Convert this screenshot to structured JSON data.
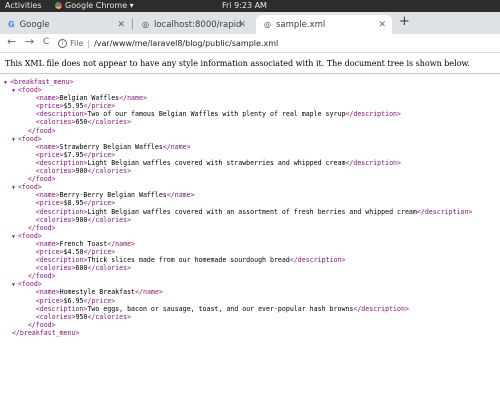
{
  "topbar": {
    "activities": "Activities",
    "app_name": "Google Chrome ▾",
    "clock": "Fri  9:23 AM"
  },
  "tabs": [
    {
      "label": "Google",
      "favicon": "G"
    },
    {
      "label": "localhost:8000/rapid",
      "favicon": "◎"
    },
    {
      "label": "sample.xml",
      "favicon": "◎"
    }
  ],
  "new_tab": "+",
  "nav": {
    "back": "←",
    "forward": "→",
    "reload": "C"
  },
  "address": {
    "scheme_label": "File",
    "separator": "|",
    "url": "/var/www/me/laravel8/blog/public/sample.xml"
  },
  "notice": "This XML file does not appear to have any style information associated with it. The document tree is shown below.",
  "xml": {
    "root": "breakfast_menu",
    "foods": [
      {
        "name": "Belgian Waffles",
        "price": "$5.95",
        "description": "Two of our famous Belgian Waffles with plenty of real maple syrup",
        "calories": "650"
      },
      {
        "name": "Strawberry Belgian Waffles",
        "price": "$7.95",
        "description": "Light Belgian waffles covered with strawberries and whipped cream",
        "calories": "900"
      },
      {
        "name": "Berry-Berry Belgian Waffles",
        "price": "$8.95",
        "description": "Light Belgian waffles covered with an assortment of fresh berries and whipped cream",
        "calories": "900"
      },
      {
        "name": "French Toast",
        "price": "$4.50",
        "description": "Thick slices made from our homemade sourdough bread",
        "calories": "600"
      },
      {
        "name": "Homestyle Breakfast",
        "price": "$6.95",
        "description": "Two eggs, bacon or sausage, toast, and our ever-popular hash browns",
        "calories": "950"
      }
    ]
  }
}
